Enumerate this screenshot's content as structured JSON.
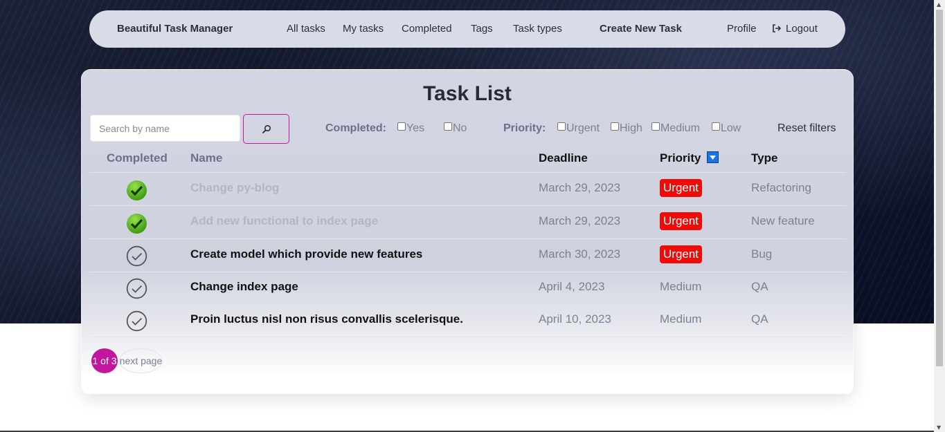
{
  "navbar": {
    "brand": "Beautiful Task Manager",
    "links": [
      "All tasks",
      "My tasks",
      "Completed",
      "Tags",
      "Task types"
    ],
    "create": "Create New Task",
    "profile": "Profile",
    "logout": "Logout"
  },
  "page": {
    "title": "Task List",
    "search_placeholder": "Search by name",
    "filters": {
      "completed_label": "Completed:",
      "completed_options": [
        "Yes",
        "No"
      ],
      "priority_label": "Priority:",
      "priority_options": [
        "Urgent",
        "High",
        "Medium",
        "Low"
      ],
      "reset": "Reset filters"
    },
    "columns": {
      "completed": "Completed",
      "name": "Name",
      "deadline": "Deadline",
      "priority": "Priority",
      "type": "Type"
    },
    "sort_icon": "sort-down-icon",
    "tasks": [
      {
        "completed": true,
        "name": "Change py-blog",
        "deadline": "March 29, 2023",
        "priority": "Urgent",
        "type": "Refactoring"
      },
      {
        "completed": true,
        "name": "Add new functional to index page",
        "deadline": "March 29, 2023",
        "priority": "Urgent",
        "type": "New feature"
      },
      {
        "completed": false,
        "name": "Create model which provide new features",
        "deadline": "March 30, 2023",
        "priority": "Urgent",
        "type": "Bug"
      },
      {
        "completed": false,
        "name": "Change index page",
        "deadline": "April 4, 2023",
        "priority": "Medium",
        "type": "QA"
      },
      {
        "completed": false,
        "name": "Proin luctus nisl non risus convallis scelerisque.",
        "deadline": "April 10, 2023",
        "priority": "Medium",
        "type": "QA"
      }
    ],
    "pagination": {
      "current": "1 of 3",
      "next": "next page"
    }
  },
  "colors": {
    "accent": "#c2169d",
    "urgent": "#f00b0b",
    "done_check": "#4fb81c"
  }
}
